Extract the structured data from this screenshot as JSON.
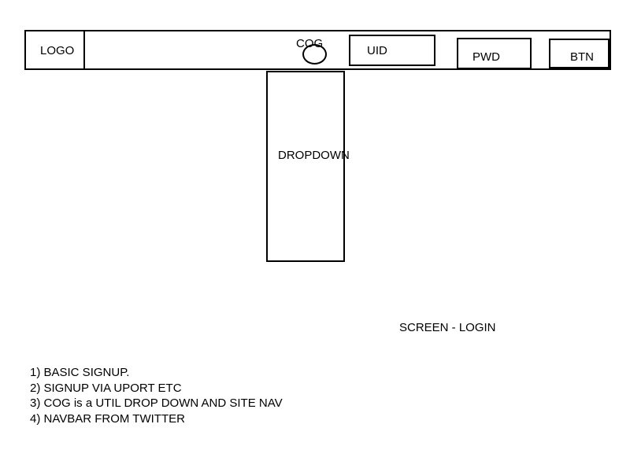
{
  "navbar": {
    "logo": "LOGO",
    "cog": "COG",
    "uid": "UID",
    "pwd": "PWD",
    "btn": "BTN"
  },
  "dropdown": {
    "label": "DROPDOWN"
  },
  "screen_title": "SCREEN - LOGIN",
  "notes": [
    "1) BASIC SIGNUP.",
    "2) SIGNUP VIA UPORT ETC",
    "3) COG is a UTIL DROP DOWN AND SITE NAV",
    "4) NAVBAR FROM TWITTER"
  ]
}
